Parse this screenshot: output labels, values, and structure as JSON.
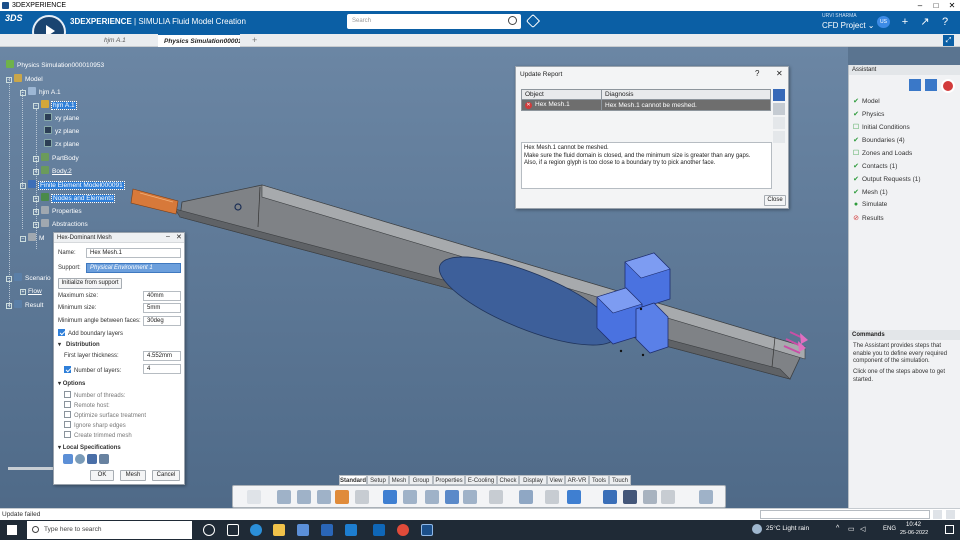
{
  "window": {
    "title": "3DEXPERIENCE"
  },
  "header": {
    "brand_strong": "3DEXPERIENCE",
    "brand_rest": " | SIMULIA Fluid Model Creation",
    "compass_version": "V,R",
    "search_placeholder": "Search",
    "user_name": "URVI SHARMA",
    "project_label": "CFD Project ⌄",
    "user_badge": "US"
  },
  "tabs": [
    {
      "label": "hjm A.1"
    },
    {
      "label": "Physics Simulation000010"
    }
  ],
  "tree": {
    "root": "Physics Simulation000010953",
    "items": [
      "Model",
      "hjm A.1",
      "hjm A.1",
      "xy plane",
      "yz plane",
      "zx plane",
      "PartBody",
      "Body.2",
      "Finite Element Model000091",
      "Nodes and Elements",
      "Properties",
      "Abstractions",
      "M",
      "Scenario",
      "Flow",
      "Result"
    ]
  },
  "hexmesh": {
    "title": "Hex-Dominant Mesh",
    "name_label": "Name:",
    "name_value": "Hex Mesh.1",
    "support_label": "Support:",
    "support_value": "Physical Environment 1",
    "init_button": "Initialize from support",
    "max_size_label": "Maximum size:",
    "max_size": "40mm",
    "min_size_label": "Minimum size:",
    "min_size": "5mm",
    "min_angle_label": "Minimum angle between faces:",
    "min_angle": "30deg",
    "boundary_layers_label": "Add boundary layers",
    "distribution_label": "Distribution",
    "first_layer_label": "First layer thickness:",
    "first_layer": "4.552mm",
    "num_layers_label": "Number of layers:",
    "num_layers": "4",
    "options_label": "Options",
    "opt_threads": "Number of threads:",
    "opt_remote": "Remote host:",
    "opt_optimize": "Optimize surface treatment",
    "opt_ignore": "Ignore sharp edges",
    "opt_trimmed": "Create trimmed mesh",
    "local_spec_label": "Local Specifications",
    "ok": "OK",
    "mesh": "Mesh",
    "cancel": "Cancel"
  },
  "report": {
    "title": "Update Report",
    "col_object": "Object",
    "col_diagnosis": "Diagnosis",
    "row_object": "Hex Mesh.1",
    "row_diagnosis": "Hex Mesh.1 cannot be meshed.",
    "detail_1": "Hex Mesh.1 cannot be meshed.",
    "detail_2": "Make sure the fluid domain is closed, and the minimum size is greater than any gaps.",
    "detail_3": "Also, if a region glyph is too close to a boundary try to pick another face.",
    "close": "Close"
  },
  "assistant": {
    "title": "Assistant",
    "steps": [
      {
        "label": "Model",
        "status": "done"
      },
      {
        "label": "Physics",
        "status": "done"
      },
      {
        "label": "Initial Conditions",
        "status": "todo"
      },
      {
        "label": "Boundaries (4)",
        "status": "done"
      },
      {
        "label": "Zones and Loads",
        "status": "todo"
      },
      {
        "label": "Contacts (1)",
        "status": "done"
      },
      {
        "label": "Output Requests (1)",
        "status": "done"
      },
      {
        "label": "Mesh (1)",
        "status": "done"
      },
      {
        "label": "Simulate",
        "status": "active"
      },
      {
        "label": "Results",
        "status": "blocked"
      }
    ],
    "commands_title": "Commands",
    "commands_text_1": "The Assistant provides steps that enable you to define every required component of the simulation.",
    "commands_text_2": "Click one of the steps above to get started."
  },
  "command_tabs": [
    "Standard",
    "Setup",
    "Mesh",
    "Group",
    "Properties",
    "E-Cooling",
    "Check",
    "Display",
    "View",
    "AR-VR",
    "Tools",
    "Touch"
  ],
  "status": {
    "text": "Update failed"
  },
  "taskbar": {
    "search_placeholder": "Type here to search",
    "weather": "25°C  Light rain",
    "lang": "ENG",
    "time": "10:42",
    "date": "25-06-2022"
  },
  "colors": {
    "brand_blue": "#0b5fa5",
    "selection": "#2f7fd9",
    "done_green": "#2e9b3b",
    "error_red": "#d23b3b"
  }
}
